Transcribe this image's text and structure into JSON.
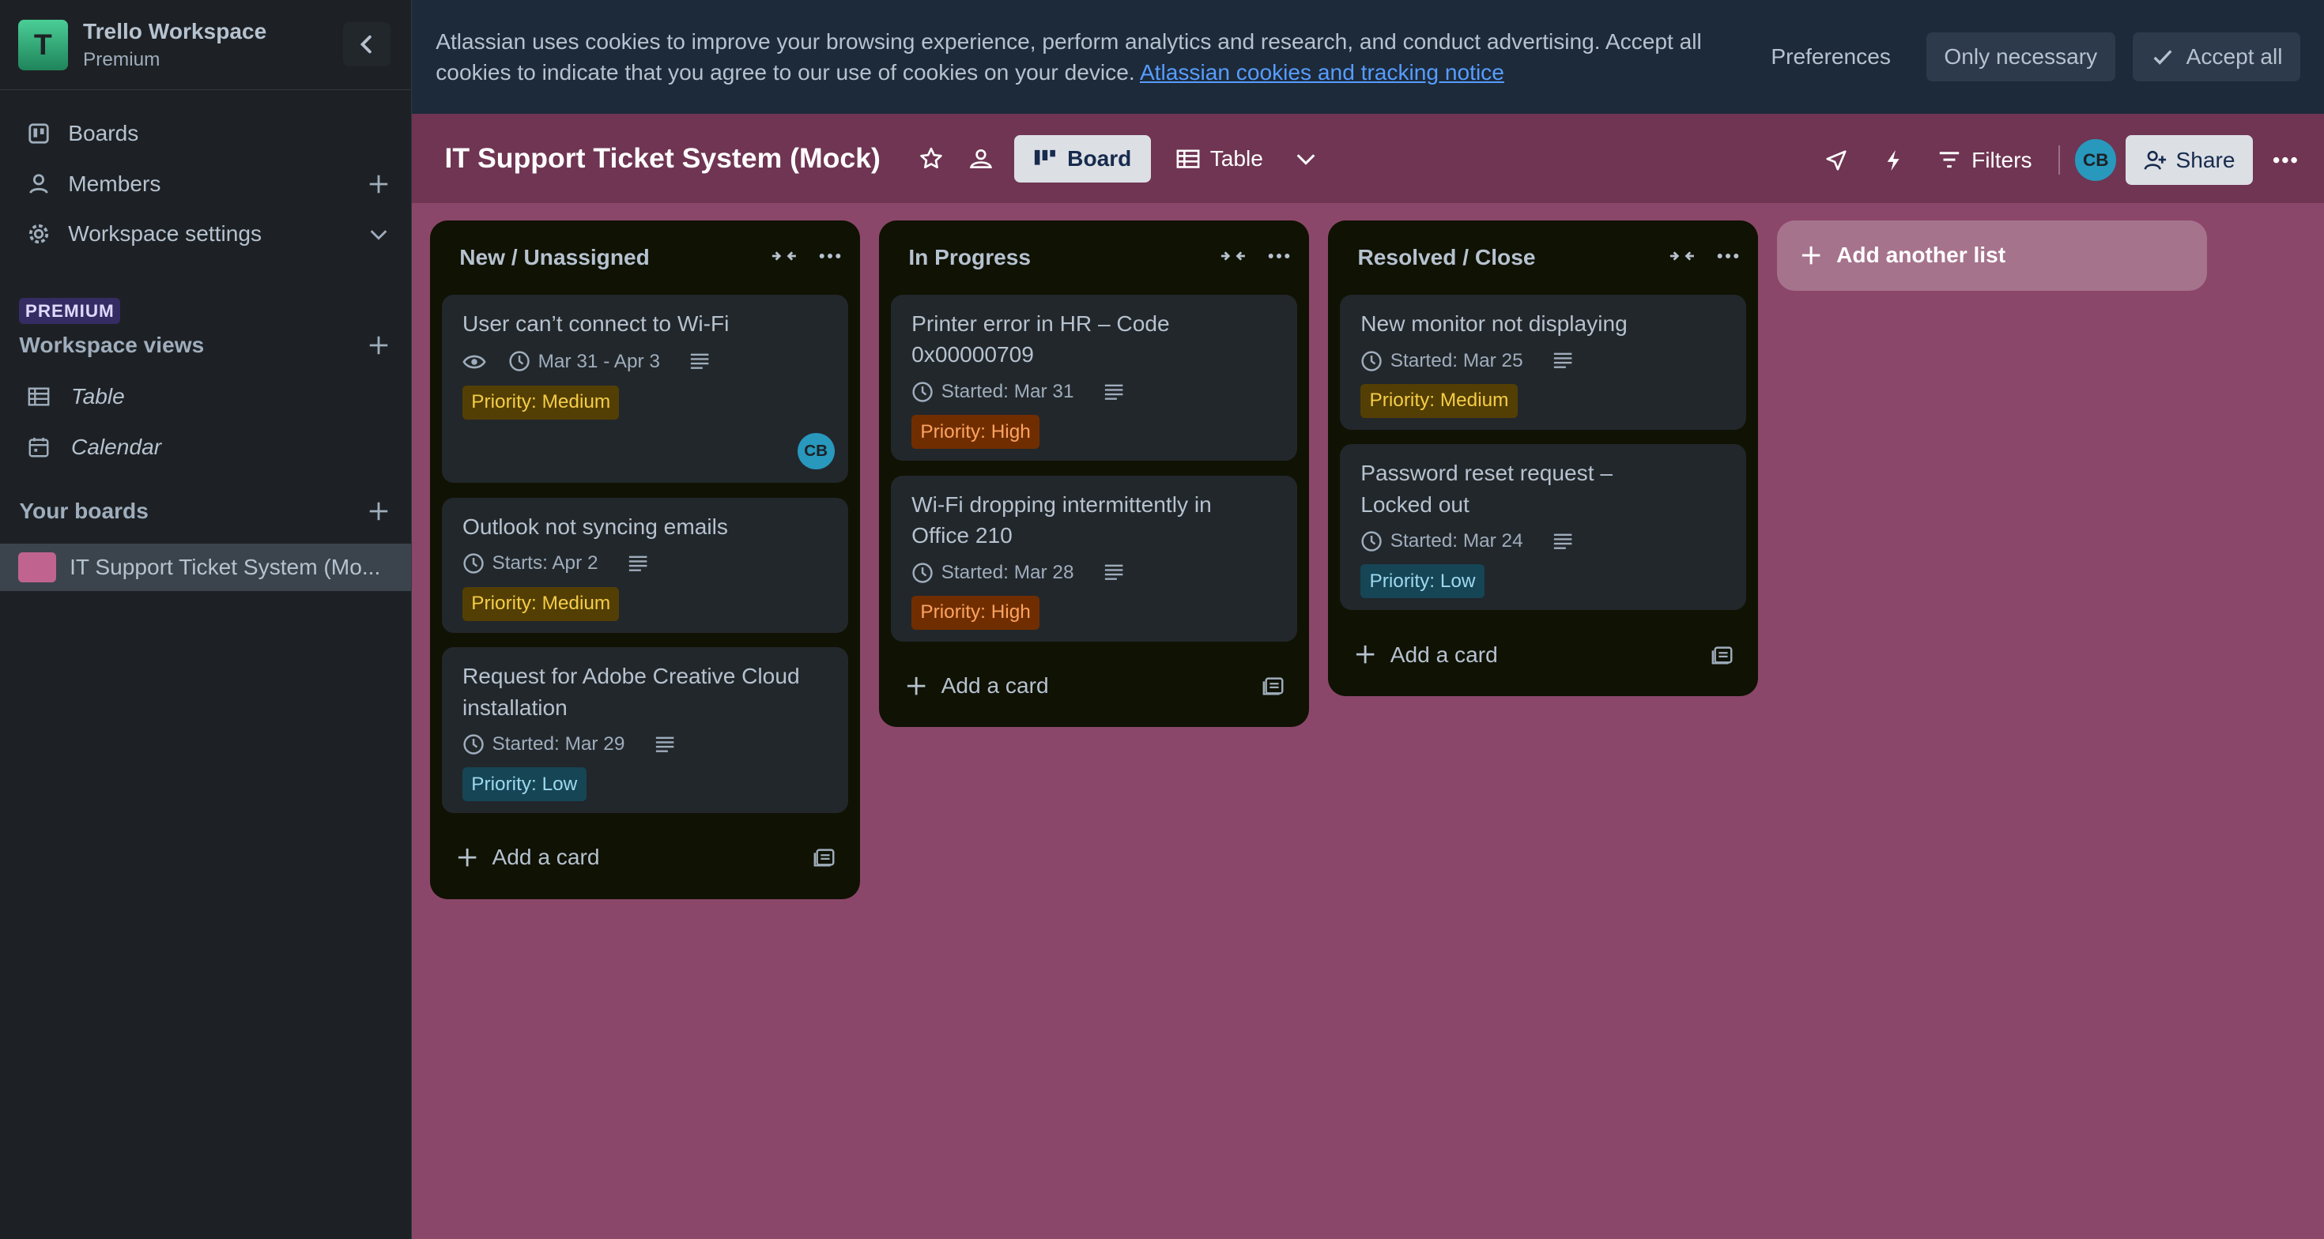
{
  "sidebar": {
    "workspace_name": "Trello Workspace",
    "workspace_plan": "Premium",
    "workspace_initial": "T",
    "nav": {
      "boards": "Boards",
      "members": "Members",
      "settings": "Workspace settings"
    },
    "premium_badge": "PREMIUM",
    "views_title": "Workspace views",
    "views": [
      "Table",
      "Calendar"
    ],
    "boards_title": "Your boards",
    "board_item": "IT Support Ticket System (Mo..."
  },
  "cookie": {
    "text": "Atlassian uses cookies to improve your browsing experience, perform analytics and research, and conduct advertising. Accept all cookies to indicate that you agree to our use of cookies on your device.",
    "link": "Atlassian cookies and tracking notice",
    "preferences": "Preferences",
    "only_necessary": "Only necessary",
    "accept_all": "Accept all"
  },
  "board": {
    "title": "IT Support Ticket System (Mock)",
    "view_board": "Board",
    "view_table": "Table",
    "filters": "Filters",
    "avatar": "CB",
    "share": "Share"
  },
  "lists": [
    {
      "title": "New / Unassigned",
      "cards": [
        {
          "title": "User can’t connect to Wi-Fi",
          "date": "Mar 31 - Apr 3",
          "label": "Priority: Medium",
          "member": "CB"
        },
        {
          "title": "Outlook not syncing emails",
          "date": "Starts: Apr 2",
          "label": "Priority: Medium"
        },
        {
          "title": "Request for Adobe Creative Cloud installation",
          "date": "Started: Mar 29",
          "label": "Priority: Low"
        }
      ],
      "add_card": "Add a card"
    },
    {
      "title": "In Progress",
      "cards": [
        {
          "title": "Printer error in HR – Code 0x00000709",
          "date": "Started: Mar 31",
          "label": "Priority: High"
        },
        {
          "title": "Wi-Fi dropping intermittently in Office 210",
          "date": "Started: Mar 28",
          "label": "Priority: High"
        }
      ],
      "add_card": "Add a card"
    },
    {
      "title": "Resolved / Close",
      "cards": [
        {
          "title": "New monitor not displaying",
          "date": "Started: Mar 25",
          "label": "Priority: Medium"
        },
        {
          "title": "Password reset request – Locked out",
          "date": "Started: Mar 24",
          "label": "Priority: Low"
        }
      ],
      "add_card": "Add a card"
    }
  ],
  "add_list": "Add another list",
  "colors": {
    "board_bg": "#8b4769",
    "header_bg": "#6f3552",
    "list_bg": "#101204",
    "card_bg": "#22272b",
    "label_medium": "#533f04",
    "label_high": "#702e00",
    "label_low": "#164555"
  }
}
